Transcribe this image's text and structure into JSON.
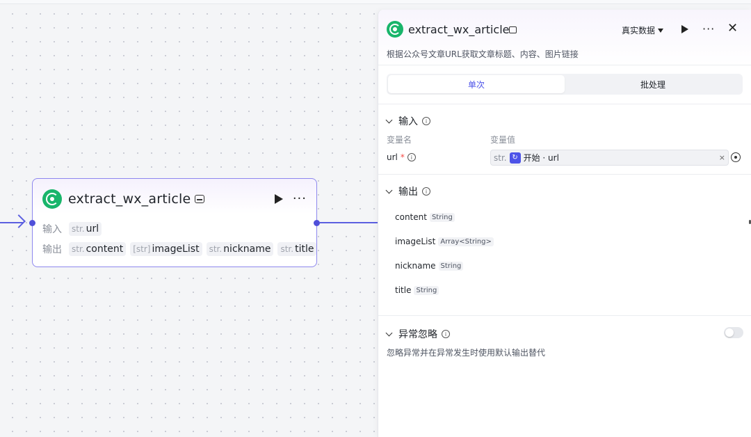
{
  "node": {
    "title": "extract_wx_article",
    "input_label": "输入",
    "output_label": "输出",
    "inputs": [
      {
        "type": "str.",
        "name": "url"
      }
    ],
    "outputs": [
      {
        "type": "str.",
        "name": "content"
      },
      {
        "type": "[str]",
        "name": "imageList"
      },
      {
        "type": "str.",
        "name": "nickname"
      },
      {
        "type": "str.",
        "name": "title"
      }
    ]
  },
  "panel": {
    "title": "extract_wx_article",
    "description": "根据公众号文章URL获取文章标题、内容、图片链接",
    "data_mode": "真实数据",
    "tabs": [
      {
        "label": "单次",
        "active": true
      },
      {
        "label": "批处理",
        "active": false
      }
    ],
    "input_section": {
      "title": "输入",
      "col_name": "变量名",
      "col_value": "变量值",
      "var_name": "url",
      "required_mark": "*",
      "value_type": "str.",
      "ref_text": "开始 · url",
      "clear_symbol": "×"
    },
    "output_section": {
      "title": "输出",
      "items": [
        {
          "name": "content",
          "type": "String"
        },
        {
          "name": "imageList",
          "type": "Array<String>"
        },
        {
          "name": "nickname",
          "type": "String"
        },
        {
          "name": "title",
          "type": "String"
        }
      ]
    },
    "exception_section": {
      "title": "异常忽略",
      "description": "忽略异常并在异常发生时使用默认输出替代",
      "enabled": false
    }
  },
  "colors": {
    "accent": "#4d53e8",
    "node_border": "#8d87ee",
    "brand_green": "#19b56b"
  },
  "icons": {
    "node_logo": "wechat-logo-icon",
    "play": "play-icon",
    "more": "more-dots-icon",
    "close": "close-icon",
    "info": "info-icon",
    "reference": "variable-reference-icon"
  }
}
